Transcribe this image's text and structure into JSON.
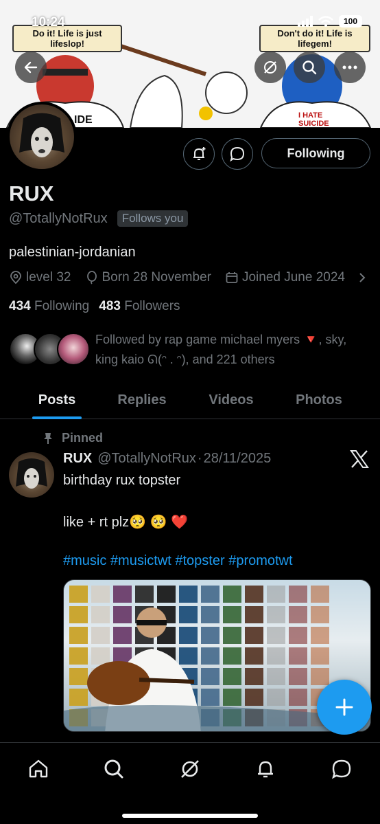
{
  "status_bar": {
    "time": "10:24",
    "battery": "100"
  },
  "banner": {
    "left_speech": "Do it! Life is just lifeslop!",
    "right_speech": "Don't do it! Life is lifegem!",
    "left_shirt": "IDE",
    "right_shirt": "I HATE SUICIDE"
  },
  "profile": {
    "name": "RUX",
    "handle": "@TotallyNotRux",
    "follows_you": "Follows you",
    "follow_button": "Following",
    "bio": "palestinian-jordanian",
    "location": "level 32",
    "birthday": "Born 28 November",
    "joined": "Joined June 2024",
    "following_count": "434",
    "following_label": "Following",
    "followers_count": "483",
    "followers_label": "Followers",
    "followed_by": "Followed by rap game michael myers 🔻, sky, king kaio ᘏ(ᵔ . ᵔ), and 221 others"
  },
  "tabs": [
    "Posts",
    "Replies",
    "Videos",
    "Photos"
  ],
  "post": {
    "pinned_label": "Pinned",
    "name": "RUX",
    "handle": "@TotallyNotRux",
    "separator": "·",
    "date": "28/11/2025",
    "line1": "birthday rux topster",
    "line2": "like + rt plz🥺 🥺 ❤️",
    "hashtags": "#music #musictwt #topster #promotwt"
  },
  "colors": {
    "accent": "#1d9bf0",
    "muted": "#71767b",
    "text": "#e7e9ea",
    "border": "#2f3336"
  },
  "nav_icons": [
    "home-icon",
    "search-icon",
    "grok-icon",
    "notifications-icon",
    "messages-icon"
  ]
}
